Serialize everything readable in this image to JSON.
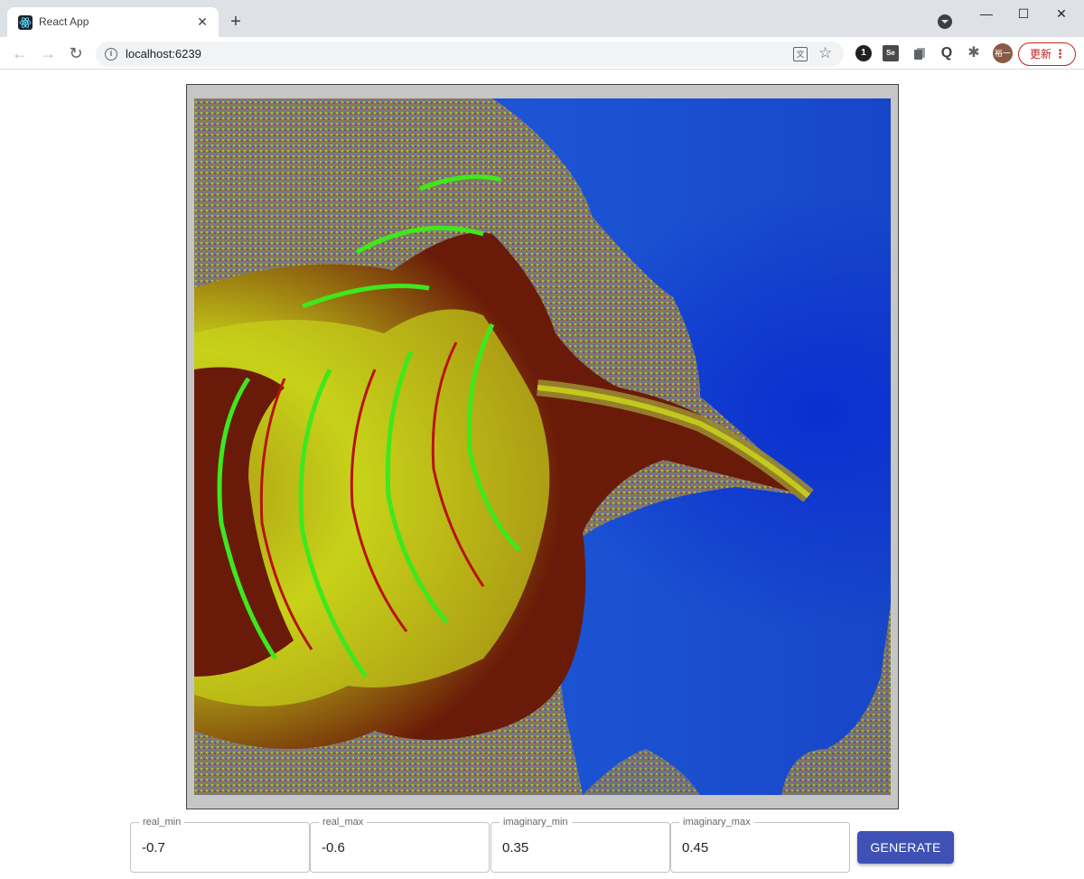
{
  "browser": {
    "tab_title": "React App",
    "tab_close": "✕",
    "new_tab": "+",
    "url": "localhost:6239",
    "update_label": "更新",
    "avatar_text": "裕一",
    "window_controls": {
      "minimize": "—",
      "maximize": "☐",
      "close": "✕"
    },
    "extensions": {
      "one": "1",
      "se": "Se",
      "q": "Q"
    }
  },
  "form": {
    "fields": [
      {
        "label": "real_min",
        "value": "-0.7"
      },
      {
        "label": "real_max",
        "value": "-0.6"
      },
      {
        "label": "imaginary_min",
        "value": "0.35"
      },
      {
        "label": "imaginary_max",
        "value": "0.45"
      }
    ],
    "generate_label": "GENERATE"
  },
  "colors": {
    "accent": "#3f51b5",
    "fractal_background": "#1b52d2",
    "fractal_band_green": "#3ee81c",
    "fractal_band_yellow": "#c8d21a",
    "fractal_band_dark": "#6a1a08"
  }
}
